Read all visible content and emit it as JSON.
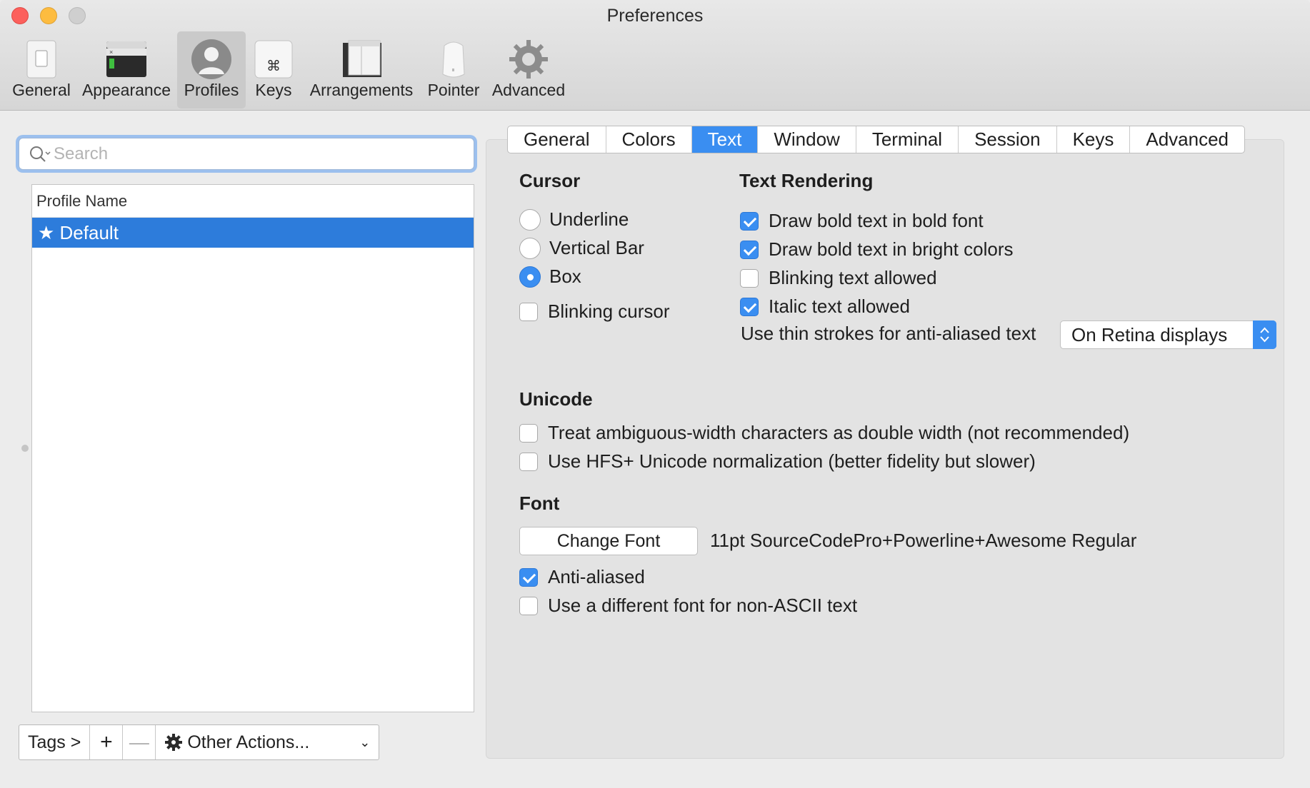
{
  "window": {
    "title": "Preferences"
  },
  "toolbar": {
    "items": [
      {
        "label": "General",
        "icon": "general-switch-icon"
      },
      {
        "label": "Appearance",
        "icon": "terminal-window-icon"
      },
      {
        "label": "Profiles",
        "icon": "user-silhouette-icon",
        "selected": true
      },
      {
        "label": "Keys",
        "icon": "command-key-icon"
      },
      {
        "label": "Arrangements",
        "icon": "window-stack-icon"
      },
      {
        "label": "Pointer",
        "icon": "mouse-icon"
      },
      {
        "label": "Advanced",
        "icon": "gear-icon"
      }
    ]
  },
  "sidebar": {
    "search_placeholder": "Search",
    "list_header": "Profile Name",
    "profiles": [
      {
        "label": "★ Default",
        "selected": true
      }
    ],
    "bottom": {
      "tags": "Tags >",
      "add": "+",
      "remove": "—",
      "actions": "Other Actions..."
    }
  },
  "tabs": [
    {
      "label": "General"
    },
    {
      "label": "Colors"
    },
    {
      "label": "Text",
      "active": true
    },
    {
      "label": "Window"
    },
    {
      "label": "Terminal"
    },
    {
      "label": "Session"
    },
    {
      "label": "Keys"
    },
    {
      "label": "Advanced"
    }
  ],
  "cursor": {
    "title": "Cursor",
    "options": [
      {
        "label": "Underline",
        "selected": false
      },
      {
        "label": "Vertical Bar",
        "selected": false
      },
      {
        "label": "Box",
        "selected": true
      }
    ],
    "blinking": {
      "label": "Blinking cursor",
      "checked": false
    }
  },
  "text_rendering": {
    "title": "Text Rendering",
    "options": [
      {
        "label": "Draw bold text in bold font",
        "checked": true
      },
      {
        "label": "Draw bold text in bright colors",
        "checked": true
      },
      {
        "label": "Blinking text allowed",
        "checked": false
      },
      {
        "label": "Italic text allowed",
        "checked": true
      }
    ],
    "thin_strokes_label": "Use thin strokes for anti-aliased text",
    "thin_strokes_value": "On Retina displays"
  },
  "unicode": {
    "title": "Unicode",
    "options": [
      {
        "label": "Treat ambiguous-width characters as double width (not recommended)",
        "checked": false
      },
      {
        "label": "Use HFS+ Unicode normalization (better fidelity but slower)",
        "checked": false
      }
    ]
  },
  "font": {
    "title": "Font",
    "change_button": "Change Font",
    "current": "11pt SourceCodePro+Powerline+Awesome Regular",
    "options": [
      {
        "label": "Anti-aliased",
        "checked": true
      },
      {
        "label": "Use a different font for non-ASCII text",
        "checked": false
      }
    ]
  },
  "colors": {
    "accent": "#3a8ef1",
    "selection": "#2d7cdb",
    "close": "#fc605c",
    "minimize": "#fdbc40"
  }
}
